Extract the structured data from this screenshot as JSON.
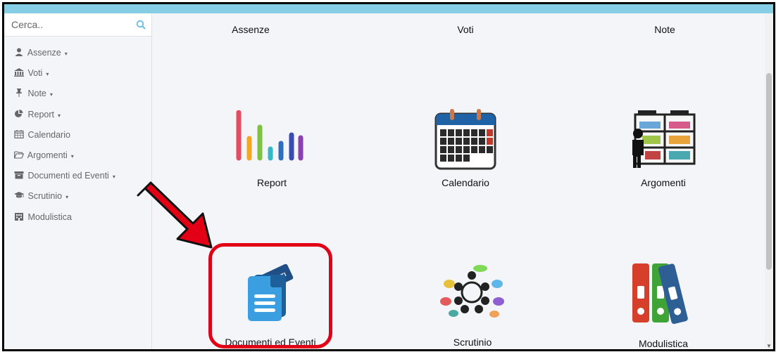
{
  "search": {
    "placeholder": "Cerca.."
  },
  "sidebar": {
    "items": [
      {
        "label": "Assenze",
        "icon": "user-icon",
        "has_caret": true
      },
      {
        "label": "Voti",
        "icon": "bank-icon",
        "has_caret": true
      },
      {
        "label": "Note",
        "icon": "pin-icon",
        "has_caret": true
      },
      {
        "label": "Report",
        "icon": "pie-chart-icon",
        "has_caret": true
      },
      {
        "label": "Calendario",
        "icon": "calendar-icon",
        "has_caret": false
      },
      {
        "label": "Argomenti",
        "icon": "folder-open-icon",
        "has_caret": true
      },
      {
        "label": "Documenti ed Eventi",
        "icon": "archive-icon",
        "has_caret": true
      },
      {
        "label": "Scrutinio",
        "icon": "graduation-cap-icon",
        "has_caret": true
      },
      {
        "label": "Modulistica",
        "icon": "building-icon",
        "has_caret": false
      }
    ],
    "caret": "▾"
  },
  "tiles": {
    "row1": [
      "Assenze",
      "Voti",
      "Note"
    ],
    "row2": [
      "Report",
      "Calendario",
      "Argomenti"
    ],
    "row3": [
      "Documenti ed Eventi",
      "Scrutinio",
      "Modulistica"
    ]
  },
  "annotation": {
    "highlighted": "Documenti ed Eventi",
    "color": "#e30016"
  },
  "colors": {
    "topbar": "#86cde6",
    "background": "#f3f5f8",
    "accent": "#2f97d8"
  }
}
